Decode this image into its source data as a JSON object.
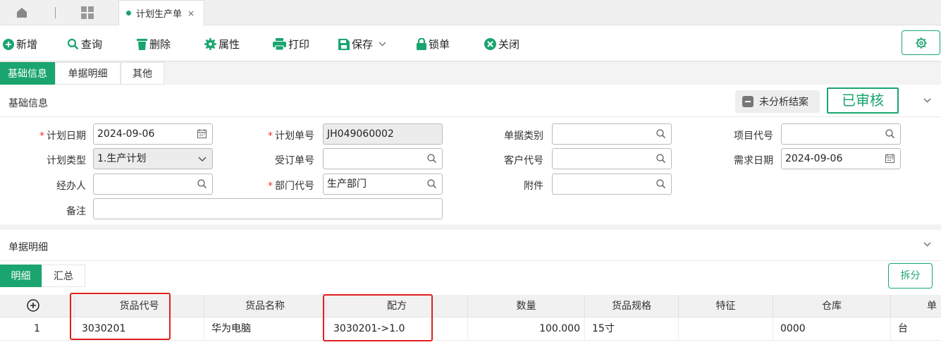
{
  "tab": {
    "title": "计划生产单",
    "close": "×"
  },
  "toolbar": {
    "add": "新增",
    "query": "查询",
    "delete": "删除",
    "props": "属性",
    "print": "打印",
    "save": "保存",
    "lock": "锁单",
    "close": "关闭"
  },
  "subtabs": [
    "基础信息",
    "单据明细",
    "其他"
  ],
  "basic": {
    "title": "基础信息",
    "unanalyzed": "未分析结案",
    "status": "已审核",
    "fields": {
      "plan_date": {
        "label": "计划日期",
        "value": "2024-09-06"
      },
      "plan_no": {
        "label": "计划单号",
        "value": "JH049060002"
      },
      "doc_type": {
        "label": "单据类别",
        "value": ""
      },
      "project_code": {
        "label": "项目代号",
        "value": ""
      },
      "plan_type": {
        "label": "计划类型",
        "value": "1.生产计划"
      },
      "order_no": {
        "label": "受订单号",
        "value": ""
      },
      "customer_code": {
        "label": "客户代号",
        "value": ""
      },
      "demand_date": {
        "label": "需求日期",
        "value": "2024-09-06"
      },
      "handler": {
        "label": "经办人",
        "value": ""
      },
      "dept_code": {
        "label": "部门代号",
        "value": "生产部门"
      },
      "attachment": {
        "label": "附件",
        "value": ""
      },
      "remark": {
        "label": "备注",
        "value": ""
      }
    },
    "required_mark": "*"
  },
  "detail": {
    "title": "单据明细",
    "tabs": [
      "明细",
      "汇总"
    ],
    "split": "拆分",
    "columns": [
      "货品代号",
      "货品名称",
      "配方",
      "数量",
      "货品规格",
      "特征",
      "仓库",
      "单"
    ],
    "rows": [
      {
        "index": "1",
        "code": "3030201",
        "name": "华为电脑",
        "formula": "3030201->1.0",
        "qty": "100.000",
        "spec": "15寸",
        "feature": "",
        "warehouse": "0000",
        "unit": "台"
      }
    ]
  },
  "colors": {
    "accent": "#1aa56e",
    "highlight": "#e02020"
  }
}
